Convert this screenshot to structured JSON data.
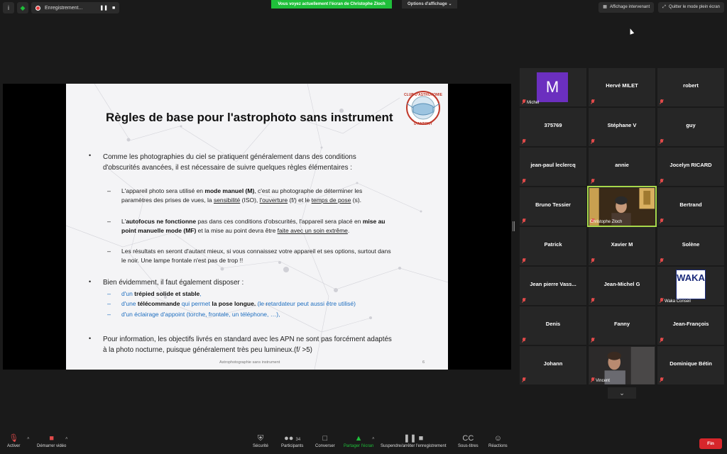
{
  "topbar": {
    "recording_label": "Enregistrement...",
    "sharing_banner": "Vous voyez actuellement l'écran de Christophe Zloch",
    "view_options": "Options d'affichage",
    "speaker_view": "Affichage intervenant",
    "exit_fullscreen": "Quitter le mode plein écran"
  },
  "slide": {
    "title": "Règles de base pour l'astrophoto sans instrument",
    "logo_text_top": "CLUB D'ASTRONOMIE",
    "logo_text_bottom": "D'ANTONY",
    "b1_l1": "Comme les photographies du ciel se pratiquent généralement dans des conditions",
    "b1_l2": "d'obscurités avancées, il est nécessaire de suivre quelques règles élémentaires :",
    "s1_a": "L'appareil photo sera utilisé en ",
    "s1_b": "mode manuel (M)",
    "s1_c": ", c'est au photographe de déterminer les",
    "s1_d": "paramètres des prises de vues, la ",
    "s1_e": "sensibilité",
    "s1_f": " (ISO), ",
    "s1_g": "l'ouverture",
    "s1_h": " (f/) et le ",
    "s1_i": "temps de pose",
    "s1_j": " (s).",
    "s2_a": "L'",
    "s2_b": "autofocus ne fonctionne",
    "s2_c": " pas dans ces conditions d'obscurités, l'appareil sera placé en ",
    "s2_d": "mise au",
    "s2_e": "point manuelle mode (MF)",
    "s2_f": " et la mise au point devra être ",
    "s2_g": "faite avec un soin extrême",
    "s2_h": ".",
    "s3_l1": "Les résultats en seront d'autant mieux, si vous connaissez votre appareil et ses options, surtout dans",
    "s3_l2": "le noir. Une lampe frontale n'est pas de trop !!",
    "b2": "Bien évidemment, il faut également disposer :",
    "d1_a": "d'un ",
    "d1_b": "trépied solide et stable",
    "d1_c": ",",
    "d2_a": "d'une ",
    "d2_b": "télécommande",
    "d2_c": " qui permet ",
    "d2_d": "la pose longue.",
    "d2_e": " (le retardateur peut aussi être utilisé)",
    "d3": "d'un éclairage d'appoint (torche, frontale, un téléphone, …),",
    "b3_l1": "Pour information, les objectifs livrés en standard avec les APN ne sont pas forcément adaptés",
    "b3_l2": "à la photo nocturne, puisque généralement très peu lumineux.(f/ >5)",
    "footer": "Astrophotographie sans instrument",
    "page": "6",
    "bullet": "•",
    "dash": "–"
  },
  "participants": [
    {
      "name": "",
      "small": "Michel",
      "avatar": "M"
    },
    {
      "name": "Hervé MILET"
    },
    {
      "name": "robert"
    },
    {
      "name": "375769"
    },
    {
      "name": "Stéphane V"
    },
    {
      "name": "guy"
    },
    {
      "name": "jean-paul leclercq"
    },
    {
      "name": "annie"
    },
    {
      "name": "Jocelyn RICARD"
    },
    {
      "name": "Bruno Tessier"
    },
    {
      "name": "",
      "small": "Christophe Zloch",
      "video": true
    },
    {
      "name": "Bertrand"
    },
    {
      "name": "Patrick"
    },
    {
      "name": "Xavier M"
    },
    {
      "name": "Solène"
    },
    {
      "name": "Jean pierre Vass..."
    },
    {
      "name": "Jean-Michel G"
    },
    {
      "name": "",
      "small": "Waka Conseil",
      "logo": "WAKA"
    },
    {
      "name": "Denis"
    },
    {
      "name": "Fanny"
    },
    {
      "name": "Jean-François"
    },
    {
      "name": "Johann"
    },
    {
      "name": "",
      "small": "Vincent",
      "video": true
    },
    {
      "name": "Dominique Bétin"
    }
  ],
  "bottombar": {
    "unmute": "Activer",
    "start_video": "Démarrer vidéo",
    "security": "Sécurité",
    "participants": "Participants",
    "participants_count": "34",
    "chat": "Converser",
    "share": "Partager l'écran",
    "pause": "Suspendre/arrêter l'enregistrement",
    "subtitles": "Sous-titres",
    "reactions": "Réactions",
    "end": "Fin"
  }
}
